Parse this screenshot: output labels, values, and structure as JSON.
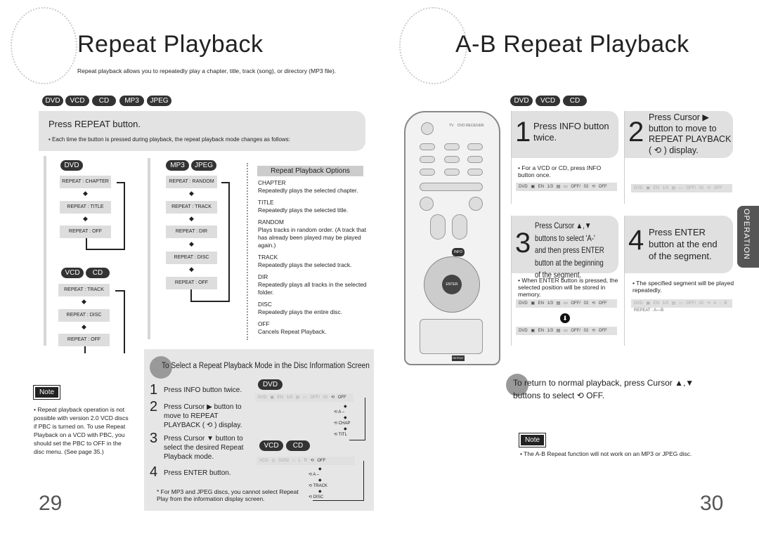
{
  "left": {
    "title": "Repeat Playback",
    "subtitle": "Repeat playback allows you to repeatedly play a chapter, title, track (song), or directory (MP3 file).",
    "discs": [
      "DVD",
      "VCD",
      "CD",
      "MP3",
      "JPEG"
    ],
    "banner": {
      "heading": "Press REPEAT button.",
      "bullet": "• Each time the button is pressed during playback, the repeat playback mode changes as follows:"
    },
    "dvd": {
      "badge": "DVD",
      "items": [
        "REPEAT : CHAPTER",
        "REPEAT : TITLE",
        "REPEAT : OFF"
      ]
    },
    "vcd": {
      "badges": [
        "VCD",
        "CD"
      ],
      "items": [
        "REPEAT : TRACK",
        "REPEAT : DISC",
        "REPEAT : OFF"
      ]
    },
    "mp3": {
      "badges": [
        "MP3",
        "JPEG"
      ],
      "items": [
        "REPEAT : RANDOM",
        "REPEAT : TRACK",
        "REPEAT : DIR",
        "REPEAT : DISC",
        "REPEAT : OFF"
      ]
    },
    "options": {
      "heading": "Repeat Playback Options",
      "items": [
        {
          "name": "CHAPTER",
          "desc": "Repeatedly plays the selected chapter."
        },
        {
          "name": "TITLE",
          "desc": "Repeatedly plays the selected title."
        },
        {
          "name": "RANDOM",
          "desc": "Plays tracks in random order. (A track that has already been played may be played again.)"
        },
        {
          "name": "TRACK",
          "desc": "Repeatedly plays the selected track."
        },
        {
          "name": "DIR",
          "desc": "Repeatedly plays all tracks in the selected folder."
        },
        {
          "name": "DISC",
          "desc": "Repeatedly plays the entire disc."
        },
        {
          "name": "OFF",
          "desc": "Cancels Repeat Playback."
        }
      ]
    },
    "info_section": {
      "heading": "To Select a Repeat Playback Mode in the Disc Information Screen",
      "steps": [
        {
          "n": "1",
          "text": "Press INFO button twice."
        },
        {
          "n": "2",
          "text": "Press Cursor ▶ button to move to REPEAT PLAYBACK ( ⟲ ) display."
        },
        {
          "n": "3",
          "text": "Press Cursor ▼ button to select the desired Repeat Playback mode."
        },
        {
          "n": "4",
          "text": "Press ENTER button."
        }
      ],
      "footnote": "* For MP3 and JPEG discs, you cannot select Repeat Play from the information display screen.",
      "dvd_badge": "DVD",
      "dvd_bar": "DVD  ▣ EN 1/3  ▤  ▭ OFF/ 02",
      "dvd_bar_sel": "⟲ OFF",
      "dvd_modes": [
        "⟲ A –",
        "⟲ CHAP",
        "⟲ TITL"
      ],
      "vcd_badges": [
        "VCD",
        "CD"
      ],
      "vcd_bar": "VCD  ◎ 02/02  ∩ L R",
      "vcd_bar_sel": "⟲ OFF",
      "vcd_modes": [
        "⟲ A –",
        "⟲ TRACK",
        "⟲ DISC"
      ]
    },
    "note_label": "Note",
    "note": "• Repeat playback operation is not possible with version 2.0 VCD discs if PBC is turned on. To use Repeat Playback on a VCD with PBC, you should set the PBC to OFF in the disc menu. (See page 35.)",
    "page": "29"
  },
  "right": {
    "title": "A-B Repeat Playback",
    "discs": [
      "DVD",
      "VCD",
      "CD"
    ],
    "steps": [
      {
        "n": "1",
        "text": "Press INFO button twice.",
        "bullet": "• For a VCD or CD, press INFO button once.",
        "bar": "DVD  ▣ EN 1/3  ▤  ▭ OFF/ 02  ⟲ OFF"
      },
      {
        "n": "2",
        "text": "Press Cursor ▶ button to move to REPEAT PLAYBACK ( ⟲ ) display.",
        "bar": "DVD  ▣ EN 1/3  ▤  ▭ OFF/ 02  ⟲ OFF"
      },
      {
        "n": "3",
        "text": "Press Cursor ▲,▼ buttons to select 'A-' and then press ENTER button at the beginning of the segment.",
        "bullet": "• When ENTER button is pressed, the selected position will be stored in memory.",
        "bar": "DVD  ▣ EN 1/3  ▤  ▭ OFF/ 02  ⟲ OFF",
        "bar2": "DVD  ▣ EN 1/3  ▤  ▭ OFF/ 02  ⟲ OFF"
      },
      {
        "n": "4",
        "text": "Press ENTER button at the end of the segment.",
        "bullet": "• The specified segment will be played repeatedly.",
        "bar": "DVD  ▣ EN 1/3  ▤  ▭ OFF/ 02  ⟲ A - B",
        "caption": "REPEAT : A—B"
      }
    ],
    "side_tab": "OPERATION",
    "return_text": "To return to normal playback, press Cursor ▲,▼ buttons to select ⟲ OFF.",
    "note_label": "Note",
    "note": "• The A-B Repeat function will not work on an MP3 or JPEG disc.",
    "page": "30",
    "remote": {
      "labels": [
        "TV",
        "DVD RECEIVER",
        "INFO",
        "ENTER",
        "REPEAT"
      ]
    }
  },
  "colors": {
    "pill": "#333333",
    "panel": "#e3e3e3",
    "box": "#dddddd"
  }
}
